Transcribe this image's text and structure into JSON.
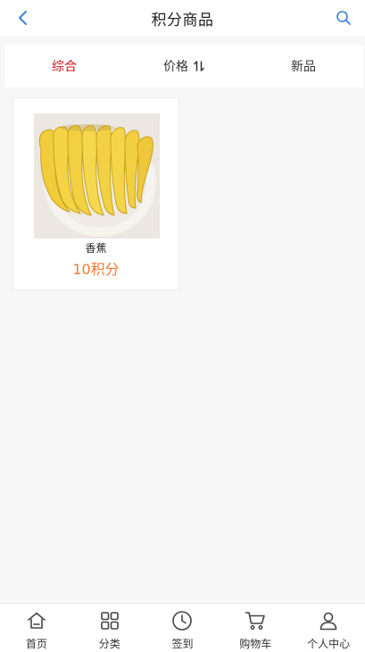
{
  "header": {
    "title": "积分商品",
    "back_icon": "chevron-left-icon",
    "search_icon": "search-icon",
    "accent_color": "#3b82d6"
  },
  "tabs": [
    {
      "label": "综合",
      "active": true
    },
    {
      "label": "价格",
      "icon": "sort-icon"
    },
    {
      "label": "新品"
    }
  ],
  "products": [
    {
      "name": "香蕉",
      "points": "10积分",
      "image": "banana-image"
    }
  ],
  "colors": {
    "active_tab": "#c8161d",
    "points": "#ee7b2f"
  },
  "tabbar": [
    {
      "label": "首页",
      "icon": "home-icon"
    },
    {
      "label": "分类",
      "icon": "category-grid-icon"
    },
    {
      "label": "签到",
      "icon": "clock-icon"
    },
    {
      "label": "购物车",
      "icon": "cart-icon"
    },
    {
      "label": "个人中心",
      "icon": "user-icon"
    }
  ]
}
